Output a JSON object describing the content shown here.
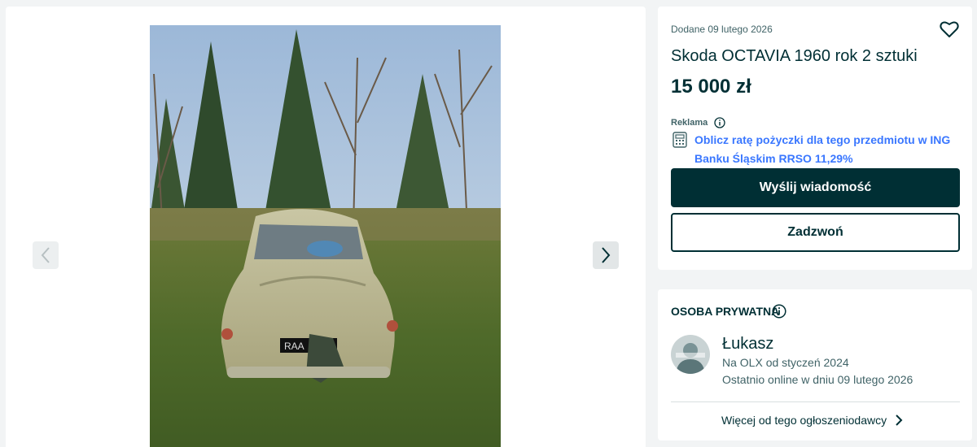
{
  "listing": {
    "date_added": "Dodane 09 lutego 2026",
    "title": "Skoda OCTAVIA 1960 rok 2 sztuki",
    "price": "15 000 zł",
    "favorite_icon": "heart-outline-icon"
  },
  "gallery": {
    "photo_subject": "car-photo",
    "prev_icon": "chevron-left-icon",
    "next_icon": "chevron-right-icon"
  },
  "ad": {
    "label": "Reklama",
    "loan_text": "Oblicz ratę pożyczki dla tego przedmiotu w ING Banku Śląskim RRSO 11,29%"
  },
  "actions": {
    "message_label": "Wyślij wiadomość",
    "call_label": "Zadzwoń"
  },
  "seller": {
    "type": "OSOBA PRYWATNA",
    "name": "Łukasz",
    "member_since": "Na OLX od styczeń 2024",
    "last_online": "Ostatnio online w dniu 09 lutego 2026",
    "more_link": "Więcej od tego ogłoszeniodawcy"
  },
  "colors": {
    "primary": "#002f34",
    "link": "#3a77ff",
    "background": "#f2f4f5"
  }
}
